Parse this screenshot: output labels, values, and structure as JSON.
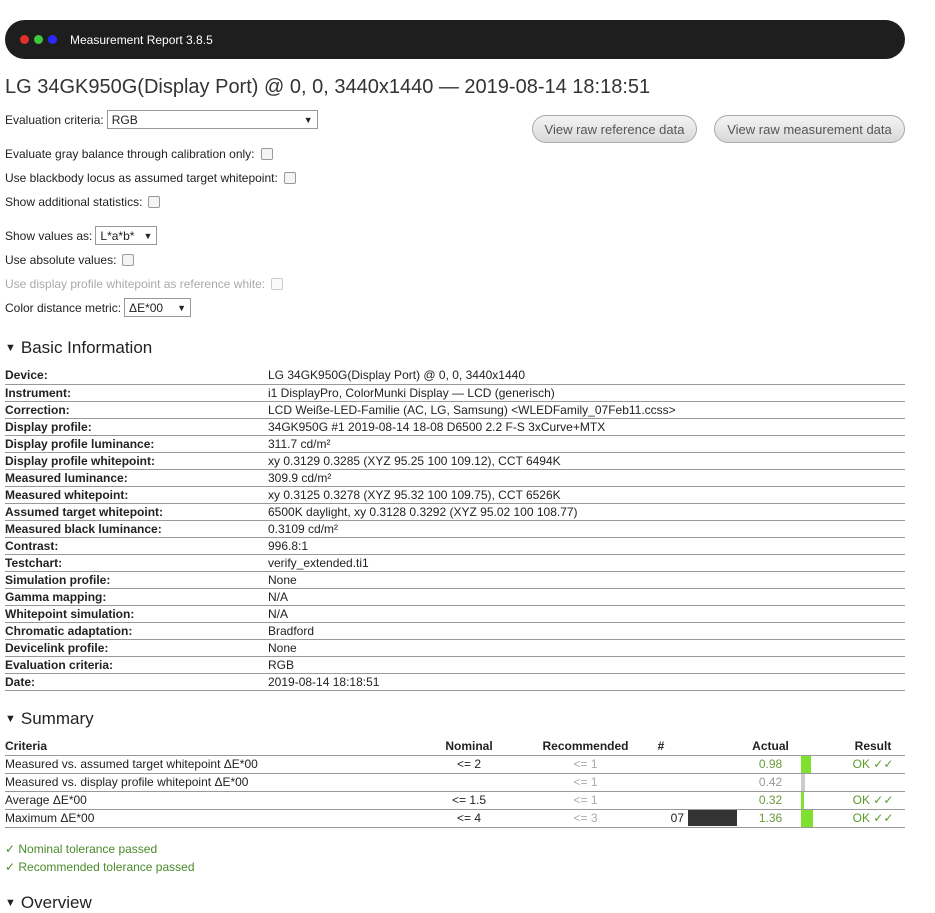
{
  "window": {
    "title": "Measurement Report 3.8.5",
    "dots": [
      "#e0302a",
      "#3ec83e",
      "#2a2aff"
    ]
  },
  "page_title": "LG 34GK950G(Display Port) @ 0, 0, 3440x1440 — 2019-08-14 18:18:51",
  "options": {
    "evaluation_criteria_label": "Evaluation criteria:",
    "evaluation_criteria_value": "RGB",
    "gray_balance_label": "Evaluate gray balance through calibration only:",
    "blackbody_label": "Use blackbody locus as assumed target whitepoint:",
    "additional_stats_label": "Show additional statistics:",
    "show_values_label": "Show values as:",
    "show_values_value": "L*a*b*",
    "absolute_values_label": "Use absolute values:",
    "profile_whitepoint_label": "Use display profile whitepoint as reference white:",
    "color_distance_label": "Color distance metric:",
    "color_distance_value": "ΔE*00"
  },
  "buttons": {
    "raw_reference": "View raw reference data",
    "raw_measurement": "View raw measurement data"
  },
  "basic_info": {
    "heading": "Basic Information",
    "rows": [
      {
        "k": "Device:",
        "v": "LG 34GK950G(Display Port) @ 0, 0, 3440x1440"
      },
      {
        "k": "Instrument:",
        "v": "i1 DisplayPro, ColorMunki Display — LCD (generisch)"
      },
      {
        "k": "Correction:",
        "v": "LCD Weiße-LED-Familie (AC, LG, Samsung) <WLEDFamily_07Feb11.ccss>"
      },
      {
        "k": "Display profile:",
        "v": "34GK950G #1 2019-08-14 18-08 D6500 2.2 F-S 3xCurve+MTX"
      },
      {
        "k": "Display profile luminance:",
        "v": "311.7 cd/m²"
      },
      {
        "k": "Display profile whitepoint:",
        "v": "xy 0.3129 0.3285 (XYZ 95.25 100 109.12), CCT 6494K"
      },
      {
        "k": "Measured luminance:",
        "v": "309.9 cd/m²"
      },
      {
        "k": "Measured whitepoint:",
        "v": "xy 0.3125 0.3278 (XYZ 95.32 100 109.75), CCT 6526K"
      },
      {
        "k": "Assumed target whitepoint:",
        "v": "6500K daylight, xy 0.3128 0.3292 (XYZ 95.02 100 108.77)"
      },
      {
        "k": "Measured black luminance:",
        "v": "0.3109 cd/m²"
      },
      {
        "k": "Contrast:",
        "v": "996.8:1"
      },
      {
        "k": "Testchart:",
        "v": "verify_extended.ti1"
      },
      {
        "k": "Simulation profile:",
        "v": "None"
      },
      {
        "k": "Gamma mapping:",
        "v": "N/A"
      },
      {
        "k": "Whitepoint simulation:",
        "v": "N/A"
      },
      {
        "k": "Chromatic adaptation:",
        "v": "Bradford"
      },
      {
        "k": "Devicelink profile:",
        "v": "None"
      },
      {
        "k": "Evaluation criteria:",
        "v": "RGB"
      },
      {
        "k": "Date:",
        "v": "2019-08-14 18:18:51"
      }
    ]
  },
  "summary": {
    "heading": "Summary",
    "headers": {
      "criteria": "Criteria",
      "nominal": "Nominal",
      "recommended": "Recommended",
      "num": "#",
      "actual": "Actual",
      "result": "Result"
    },
    "rows": [
      {
        "criteria": "Measured vs. assumed target whitepoint ΔE*00",
        "nominal": "<= 2",
        "recommended": "<= 1",
        "num": "",
        "actual": "0.98",
        "result": "OK ✓✓",
        "indicator": "#7fe030",
        "level": 0.98
      },
      {
        "criteria": "Measured vs. display profile whitepoint ΔE*00",
        "nominal": "",
        "recommended": "<= 1",
        "num": "",
        "actual": "0.42",
        "result": "",
        "indicator": "#cccccc",
        "level": 0.42
      },
      {
        "criteria": "Average ΔE*00",
        "nominal": "<= 1.5",
        "recommended": "<= 1",
        "num": "",
        "actual": "0.32",
        "result": "OK ✓✓",
        "indicator": "#7fe030",
        "level": 0.32
      },
      {
        "criteria": "Maximum ΔE*00",
        "nominal": "<= 4",
        "recommended": "<= 3",
        "num": "07",
        "actual": "1.36",
        "result": "OK ✓✓",
        "indicator": "#7fe030",
        "level": 1.36
      }
    ],
    "nominal_passed": "✓ Nominal tolerance passed",
    "recommended_passed": "✓ Recommended tolerance passed"
  },
  "overview": {
    "heading": "Overview"
  }
}
